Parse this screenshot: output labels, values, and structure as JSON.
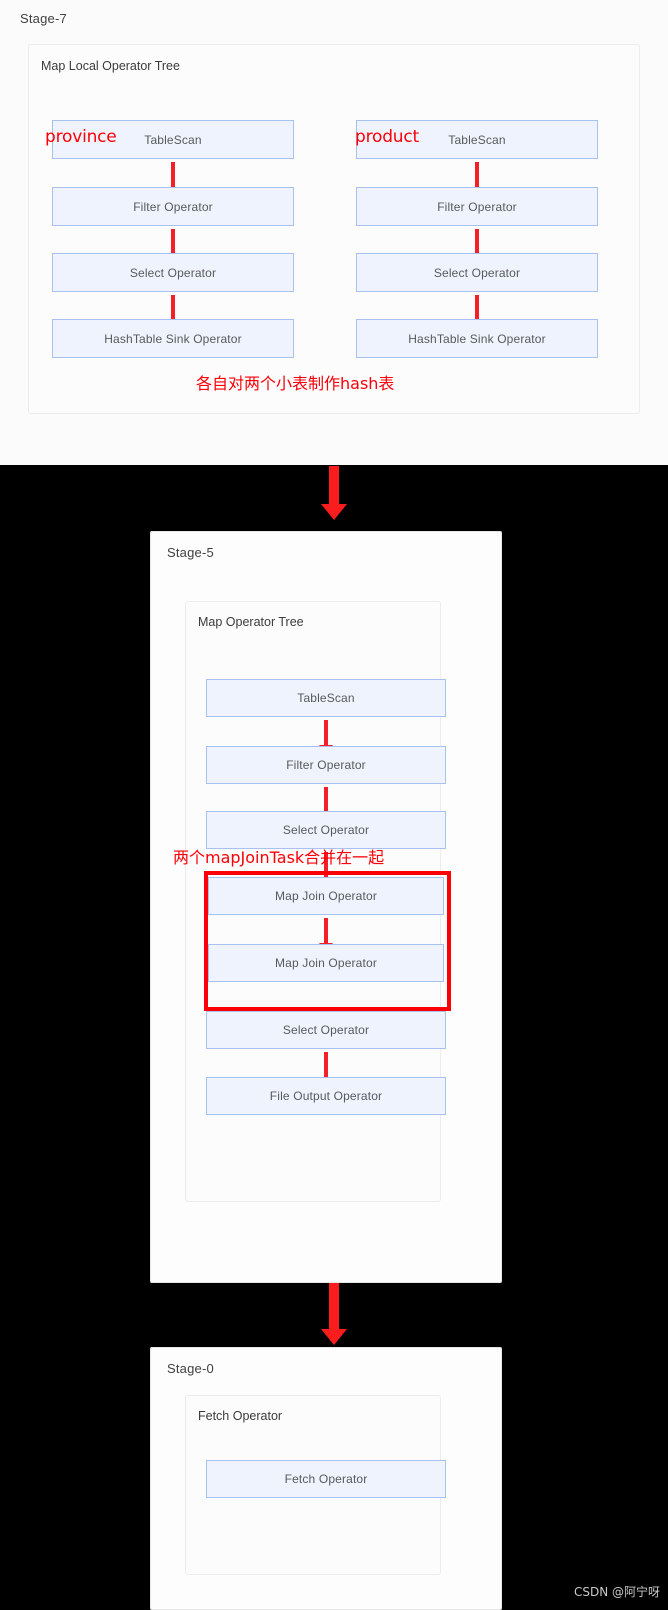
{
  "colors": {
    "page_background": "#000000",
    "panel_background": "#fdfdfd",
    "operator_fill": "#eff3fd",
    "operator_border": "#a8c1ef",
    "operator_text": "#58595b",
    "annotation_red": "#fb0007",
    "arrow_red": "#f32029",
    "watermark_text": "#c9c9c9"
  },
  "stages": [
    {
      "id": "stage-7",
      "title": "Stage-7",
      "subtree_title": "Map Local Operator Tree",
      "columns": [
        {
          "tag": "province",
          "operators": [
            "TableScan",
            "Filter Operator",
            "Select Operator",
            "HashTable Sink Operator"
          ]
        },
        {
          "tag": "product",
          "operators": [
            "TableScan",
            "Filter Operator",
            "Select Operator",
            "HashTable Sink Operator"
          ]
        }
      ],
      "caption": "各自对两个小表制作hash表"
    },
    {
      "id": "stage-5",
      "title": "Stage-5",
      "subtree_title": "Map Operator Tree",
      "operators": [
        "TableScan",
        "Filter Operator",
        "Select Operator",
        "Map Join Operator",
        "Map Join Operator",
        "Select Operator",
        "File Output Operator"
      ],
      "annotation": "两个mapJoinTask合并在一起",
      "highlight_label": "map-join-merge-highlight"
    },
    {
      "id": "stage-0",
      "title": "Stage-0",
      "subtree_title": "Fetch Operator",
      "operators": [
        "Fetch Operator"
      ]
    }
  ],
  "flow_arrows": [
    {
      "name": "stage7-to-stage5",
      "from": "stage-7",
      "to": "stage-5"
    },
    {
      "name": "stage5-to-stage0",
      "from": "stage-5",
      "to": "stage-0"
    }
  ],
  "watermark": "CSDN @阿宁呀"
}
